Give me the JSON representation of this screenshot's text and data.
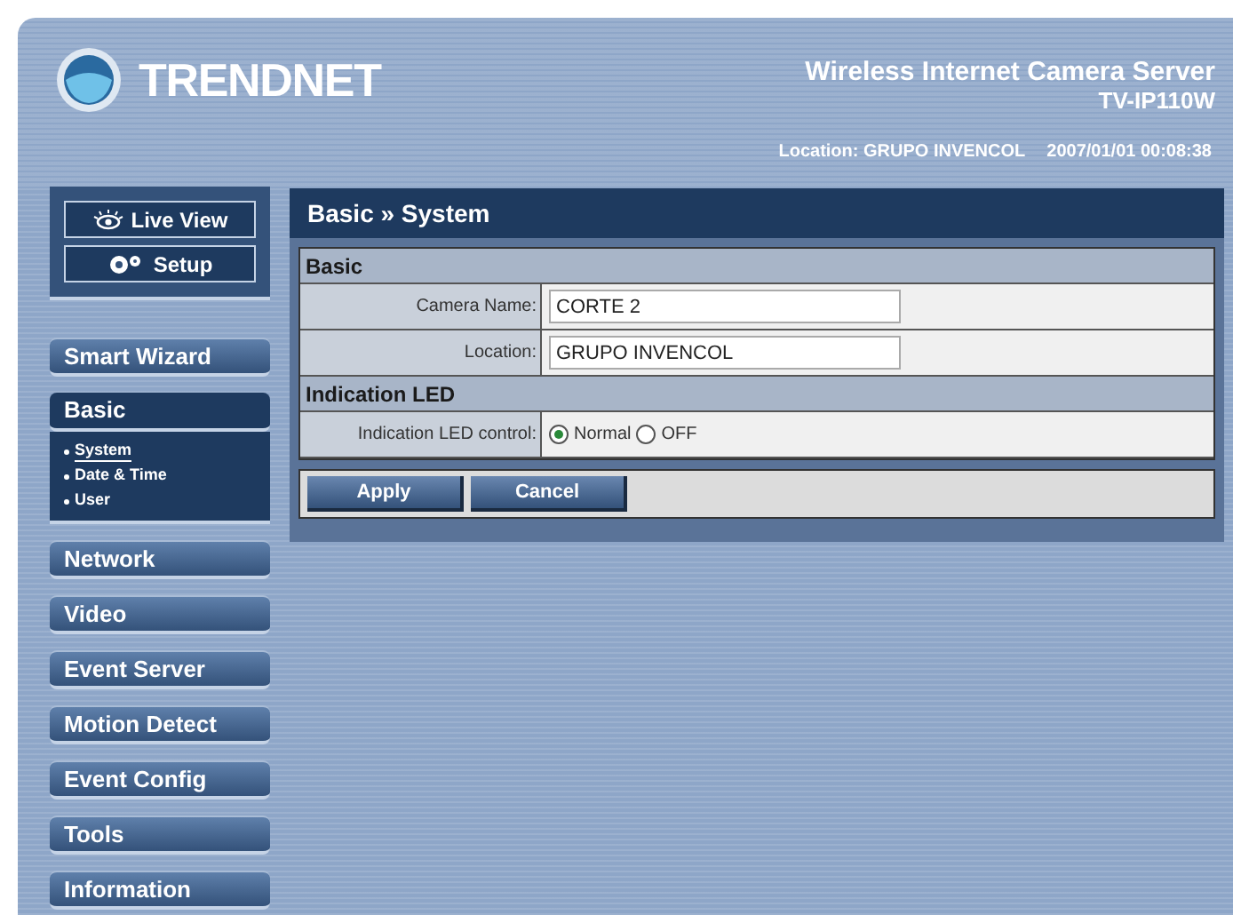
{
  "header": {
    "logo_text": "TRENDNET",
    "product_title": "Wireless Internet Camera Server",
    "model": "TV-IP110W",
    "location": "Location: GRUPO INVENCOL",
    "datetime": "2007/01/01 00:08:38"
  },
  "mode_buttons": [
    {
      "label": "Live View",
      "kind": "eye"
    },
    {
      "label": "Setup",
      "kind": "gears"
    }
  ],
  "nav": [
    {
      "label": "Smart Wizard",
      "selected": false
    },
    {
      "label": "Basic",
      "selected": true,
      "children": [
        {
          "label": "System",
          "selected": true
        },
        {
          "label": "Date & Time",
          "selected": false
        },
        {
          "label": "User",
          "selected": false
        }
      ]
    },
    {
      "label": "Network",
      "selected": false
    },
    {
      "label": "Video",
      "selected": false
    },
    {
      "label": "Event Server",
      "selected": false
    },
    {
      "label": "Motion Detect",
      "selected": false
    },
    {
      "label": "Event Config",
      "selected": false
    },
    {
      "label": "Tools",
      "selected": false
    },
    {
      "label": "Information",
      "selected": false
    }
  ],
  "page_title": "Basic » System",
  "sections": [
    {
      "title": "Basic",
      "rows": [
        {
          "kind": "text",
          "label": "Camera Name:",
          "value": "CORTE 2"
        },
        {
          "kind": "text",
          "label": "Location:",
          "value": "GRUPO INVENCOL"
        }
      ]
    },
    {
      "title": "Indication LED",
      "rows": [
        {
          "kind": "radio",
          "label": "Indication LED control:",
          "options": [
            {
              "label": "Normal",
              "selected": true
            },
            {
              "label": "OFF",
              "selected": false
            }
          ]
        }
      ]
    }
  ],
  "buttons": [
    "Apply",
    "Cancel"
  ]
}
